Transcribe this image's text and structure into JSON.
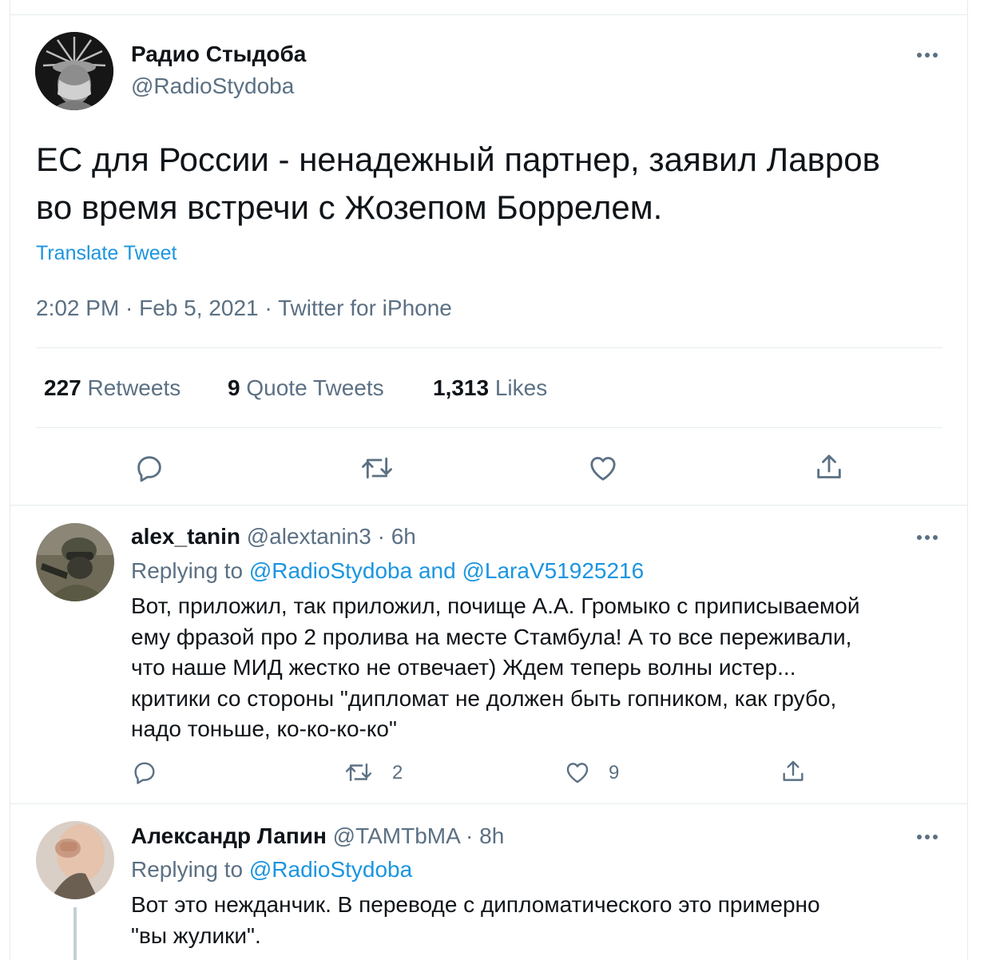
{
  "main_tweet": {
    "display_name": "Радио Стыдоба",
    "handle": "@RadioStydoba",
    "text_line1": "ЕС для России - ненадежный партнер, заявил Лавров",
    "text_line2": "во время встречи с Жозепом Боррелем.",
    "translate": "Translate Tweet",
    "meta": "2:02 PM · Feb 5, 2021 · Twitter for iPhone",
    "stats": {
      "retweets_count": "227",
      "retweets_label": "Retweets",
      "quotes_count": "9",
      "quotes_label": "Quote Tweets",
      "likes_count": "1,313",
      "likes_label": "Likes"
    }
  },
  "replies": [
    {
      "display_name": "alex_tanin",
      "handle": "@alextanin3",
      "time": "· 6h",
      "replying_prefix": "Replying to",
      "replying_to": "@RadioStydoba and @LaraV51925216",
      "lines": [
        "Вот, приложил, так приложил, почище А.А. Громыко с приписываемой",
        "ему фразой про 2 пролива на месте Стамбула! А то все переживали,",
        "что наше МИД жестко не отвечает) Ждем теперь волны истер...",
        "критики со стороны \"дипломат не должен быть гопником, как грубо,",
        "надо тоньше, ко-ко-ко-ко\""
      ],
      "retweet_count": "2",
      "like_count": "9"
    },
    {
      "display_name": "Александр Лапин",
      "handle": "@TAMTbMA",
      "time": "· 8h",
      "replying_prefix": "Replying to",
      "replying_to": "@RadioStydoba",
      "lines": [
        "Вот это нежданчик. В переводе с дипломатического это примерно",
        "\"вы жулики\"."
      ]
    }
  ],
  "colors": {
    "text": "#0f1419",
    "secondary": "#5b7083",
    "link": "#1b95e0",
    "border": "#e6ecf0"
  },
  "icons": [
    "reply-icon",
    "retweet-icon",
    "like-icon",
    "share-icon",
    "more-icon"
  ]
}
